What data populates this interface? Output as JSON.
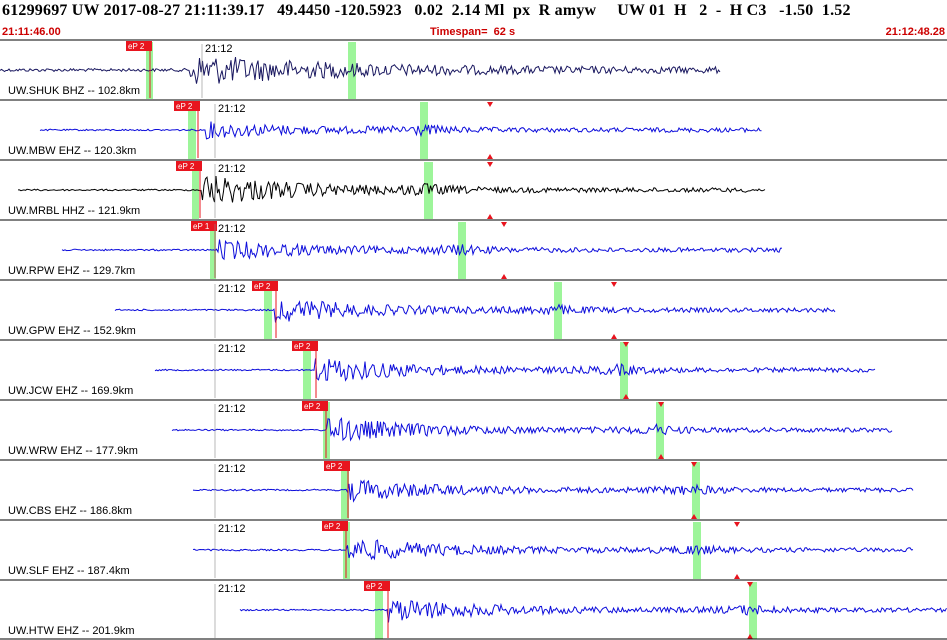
{
  "header": {
    "title": "61299697 UW 2017-08-27 21:11:39.17   49.4450 -120.5923   0.02  2.14 Ml  px  R amyw     UW 01  H   2  -  H C3   -1.50  1.52",
    "start_time": "21:11:46.00",
    "timespan": "Timespan=  62 s",
    "end_time": "21:12:48.28"
  },
  "colors": {
    "phase_label": "#e8141e",
    "pick_line": "#e8141e",
    "marker": "#e8141e",
    "band": "#9df59a",
    "trace_dark": "#1a1860",
    "trace_blue": "#0d0ddb",
    "trace_black": "#000000"
  },
  "minute_label": "21:12",
  "traces": [
    {
      "label": "UW.SHUK BHZ -- 102.8km",
      "pick_label": "eP 2",
      "color": "#1a1860"
    },
    {
      "label": "UW.MBW EHZ -- 120.3km",
      "pick_label": "eP 2",
      "color": "#0d0ddb"
    },
    {
      "label": "UW.MRBL HHZ -- 121.9km",
      "pick_label": "eP 2",
      "color": "#000000"
    },
    {
      "label": "UW.RPW EHZ -- 129.7km",
      "pick_label": "eP 1",
      "color": "#0d0ddb"
    },
    {
      "label": "UW.GPW EHZ -- 152.9km",
      "pick_label": "eP 2",
      "color": "#0d0ddb"
    },
    {
      "label": "UW.JCW EHZ -- 169.9km",
      "pick_label": "eP 2",
      "color": "#0d0ddb"
    },
    {
      "label": "UW.WRW EHZ -- 177.9km",
      "pick_label": "eP 2",
      "color": "#0d0ddb"
    },
    {
      "label": "UW.CBS EHZ -- 186.8km",
      "pick_label": "eP 2",
      "color": "#0d0ddb"
    },
    {
      "label": "UW.SLF EHZ -- 187.4km",
      "pick_label": "eP 2",
      "color": "#0d0ddb"
    },
    {
      "label": "UW.HTW EHZ -- 201.9km",
      "pick_label": "eP 2",
      "color": "#0d0ddb"
    }
  ]
}
